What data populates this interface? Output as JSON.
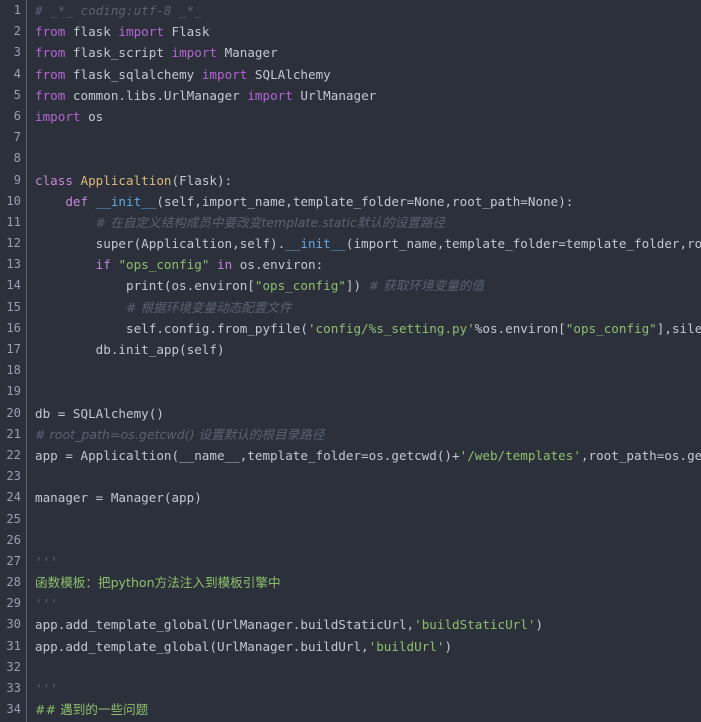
{
  "editor": {
    "title": "python-code-editor",
    "language": "Python",
    "theme": "dark",
    "background_color": "#2b303b",
    "gutter_color": "#2b303b",
    "gutter_rule_color": "#5b6270",
    "line_number_color": "#93a1b0",
    "total_lines": 34,
    "first_visible_line": 1,
    "last_visible_line": 34,
    "wrap": false,
    "colors": {
      "keyword": "#c586d8",
      "string": "#8fbf6e",
      "class_name": "#ddbb7a",
      "function": "#62a9e0",
      "comment": "#596273",
      "plain_text": "#c2c8d2"
    }
  },
  "line_numbers": [
    "1",
    "2",
    "3",
    "4",
    "5",
    "6",
    "7",
    "8",
    "9",
    "10",
    "11",
    "12",
    "13",
    "14",
    "15",
    "16",
    "17",
    "18",
    "19",
    "20",
    "21",
    "22",
    "23",
    "24",
    "25",
    "26",
    "27",
    "28",
    "29",
    "30",
    "31",
    "32",
    "33",
    "34"
  ],
  "lines": [
    {
      "n": 1,
      "text": "# _*_ coding:utf-8 _*_",
      "tokens": [
        {
          "t": "# _*_ coding:utf-8 _*_",
          "c": "com"
        }
      ]
    },
    {
      "n": 2,
      "text": "from flask import Flask",
      "tokens": [
        {
          "t": "from",
          "c": "kw2"
        },
        {
          "t": " flask ",
          "c": "plain"
        },
        {
          "t": "import",
          "c": "kw2"
        },
        {
          "t": " Flask",
          "c": "plain"
        }
      ]
    },
    {
      "n": 3,
      "text": "from flask_script import Manager",
      "tokens": [
        {
          "t": "from",
          "c": "kw2"
        },
        {
          "t": " flask_script ",
          "c": "plain"
        },
        {
          "t": "import",
          "c": "kw2"
        },
        {
          "t": " Manager",
          "c": "plain"
        }
      ]
    },
    {
      "n": 4,
      "text": "from flask_sqlalchemy import SQLAlchemy",
      "tokens": [
        {
          "t": "from",
          "c": "kw2"
        },
        {
          "t": " flask_sqlalchemy ",
          "c": "plain"
        },
        {
          "t": "import",
          "c": "kw2"
        },
        {
          "t": " SQLAlchemy",
          "c": "plain"
        }
      ]
    },
    {
      "n": 5,
      "text": "from common.libs.UrlManager import UrlManager",
      "tokens": [
        {
          "t": "from",
          "c": "kw2"
        },
        {
          "t": " common.libs.UrlManager ",
          "c": "plain"
        },
        {
          "t": "import",
          "c": "kw2"
        },
        {
          "t": " UrlManager",
          "c": "plain"
        }
      ]
    },
    {
      "n": 6,
      "text": "import os",
      "tokens": [
        {
          "t": "import",
          "c": "kw2"
        },
        {
          "t": " os",
          "c": "plain"
        }
      ]
    },
    {
      "n": 7,
      "text": "",
      "tokens": []
    },
    {
      "n": 8,
      "text": "",
      "tokens": []
    },
    {
      "n": 9,
      "text": "class Applicaltion(Flask):",
      "tokens": [
        {
          "t": "class",
          "c": "kw"
        },
        {
          "t": " ",
          "c": "plain"
        },
        {
          "t": "Applicaltion",
          "c": "cls"
        },
        {
          "t": "(Flask):",
          "c": "plain"
        }
      ]
    },
    {
      "n": 10,
      "text": "    def __init__(self,import_name,template_folder=None,root_path=None):",
      "tokens": [
        {
          "t": "    ",
          "c": "plain"
        },
        {
          "t": "def",
          "c": "kw"
        },
        {
          "t": " ",
          "c": "plain"
        },
        {
          "t": "__init__",
          "c": "fn"
        },
        {
          "t": "(self,import_name,template_folder=None,root_path=None):",
          "c": "plain"
        }
      ]
    },
    {
      "n": 11,
      "text": "        # 在自定义结构成员中要改变template.static默认的设置路径",
      "tokens": [
        {
          "t": "        ",
          "c": "plain"
        },
        {
          "t": "# 在自定义结构成员中要改变template.static默认的设置路径",
          "c": "com"
        }
      ]
    },
    {
      "n": 12,
      "text": "        super(Applicaltion,self).__init__(import_name,template_folder=template_folder,root_path=root_path)",
      "tokens": [
        {
          "t": "        super(Applicaltion,self).",
          "c": "plain"
        },
        {
          "t": "__init__",
          "c": "fn"
        },
        {
          "t": "(import_name,template_folder=template_folder,root_path=root_path)",
          "c": "plain"
        }
      ]
    },
    {
      "n": 13,
      "text": "        if \"ops_config\" in os.environ:",
      "tokens": [
        {
          "t": "        ",
          "c": "plain"
        },
        {
          "t": "if",
          "c": "kw"
        },
        {
          "t": " ",
          "c": "plain"
        },
        {
          "t": "\"ops_config\"",
          "c": "str"
        },
        {
          "t": " ",
          "c": "plain"
        },
        {
          "t": "in",
          "c": "kw"
        },
        {
          "t": " os.environ:",
          "c": "plain"
        }
      ]
    },
    {
      "n": 14,
      "text": "            print(os.environ[\"ops_config\"]) # 获取环境变量的值",
      "tokens": [
        {
          "t": "            print(os.environ[",
          "c": "plain"
        },
        {
          "t": "\"ops_config\"",
          "c": "str"
        },
        {
          "t": "]) ",
          "c": "plain"
        },
        {
          "t": "# 获取环境变量的值",
          "c": "com"
        }
      ]
    },
    {
      "n": 15,
      "text": "            # 根据环境变量动态配置文件",
      "tokens": [
        {
          "t": "            ",
          "c": "plain"
        },
        {
          "t": "# 根据环境变量动态配置文件",
          "c": "com"
        }
      ]
    },
    {
      "n": 16,
      "text": "            self.config.from_pyfile('config/%s_setting.py'%os.environ[\"ops_config\"],silent=True)",
      "tokens": [
        {
          "t": "            self.config.from_pyfile(",
          "c": "plain"
        },
        {
          "t": "'config/%s_setting.py'",
          "c": "str"
        },
        {
          "t": "%os.environ[",
          "c": "plain"
        },
        {
          "t": "\"ops_config\"",
          "c": "str"
        },
        {
          "t": "],silent=True)",
          "c": "plain"
        }
      ]
    },
    {
      "n": 17,
      "text": "        db.init_app(self)",
      "tokens": [
        {
          "t": "        db.init_app(self)",
          "c": "plain"
        }
      ]
    },
    {
      "n": 18,
      "text": "",
      "tokens": []
    },
    {
      "n": 19,
      "text": "",
      "tokens": []
    },
    {
      "n": 20,
      "text": "db = SQLAlchemy()",
      "tokens": [
        {
          "t": "db = SQLAlchemy()",
          "c": "plain"
        }
      ]
    },
    {
      "n": 21,
      "text": "# root_path=os.getcwd() 设置默认的根目录路径",
      "tokens": [
        {
          "t": "# root_path=os.getcwd() 设置默认的根目录路径",
          "c": "com"
        }
      ]
    },
    {
      "n": 22,
      "text": "app = Applicaltion(__name__,template_folder=os.getcwd()+'/web/templates',root_path=os.getcwd())",
      "tokens": [
        {
          "t": "app = Applicaltion(__name__,template_folder=os.getcwd()+",
          "c": "plain"
        },
        {
          "t": "'/web/templates'",
          "c": "str"
        },
        {
          "t": ",root_path=os.getcwd())",
          "c": "plain"
        }
      ]
    },
    {
      "n": 23,
      "text": "",
      "tokens": []
    },
    {
      "n": 24,
      "text": "manager = Manager(app)",
      "tokens": [
        {
          "t": "manager = Manager(app)",
          "c": "plain"
        }
      ]
    },
    {
      "n": 25,
      "text": "",
      "tokens": []
    },
    {
      "n": 26,
      "text": "",
      "tokens": []
    },
    {
      "n": 27,
      "text": "'''",
      "tokens": [
        {
          "t": "'''",
          "c": "doc"
        }
      ]
    },
    {
      "n": 28,
      "text": "函数模板：把python方法注入到模板引擎中",
      "tokens": [
        {
          "t": "函数模板：把python方法注入到模板引擎中",
          "c": "mdh"
        }
      ]
    },
    {
      "n": 29,
      "text": "'''",
      "tokens": [
        {
          "t": "'''",
          "c": "doc"
        }
      ]
    },
    {
      "n": 30,
      "text": "app.add_template_global(UrlManager.buildStaticUrl,'buildStaticUrl')",
      "tokens": [
        {
          "t": "app.add_template_global(UrlManager.buildStaticUrl,",
          "c": "plain"
        },
        {
          "t": "'buildStaticUrl'",
          "c": "str"
        },
        {
          "t": ")",
          "c": "plain"
        }
      ]
    },
    {
      "n": 31,
      "text": "app.add_template_global(UrlManager.buildUrl,'buildUrl')",
      "tokens": [
        {
          "t": "app.add_template_global(UrlManager.buildUrl,",
          "c": "plain"
        },
        {
          "t": "'buildUrl'",
          "c": "str"
        },
        {
          "t": ")",
          "c": "plain"
        }
      ]
    },
    {
      "n": 32,
      "text": "",
      "tokens": []
    },
    {
      "n": 33,
      "text": "'''",
      "tokens": [
        {
          "t": "'''",
          "c": "doc"
        }
      ]
    },
    {
      "n": 34,
      "text": "## 遇到的一些问题",
      "tokens": [
        {
          "t": "## 遇到的一些问题",
          "c": "mdh"
        }
      ]
    }
  ]
}
